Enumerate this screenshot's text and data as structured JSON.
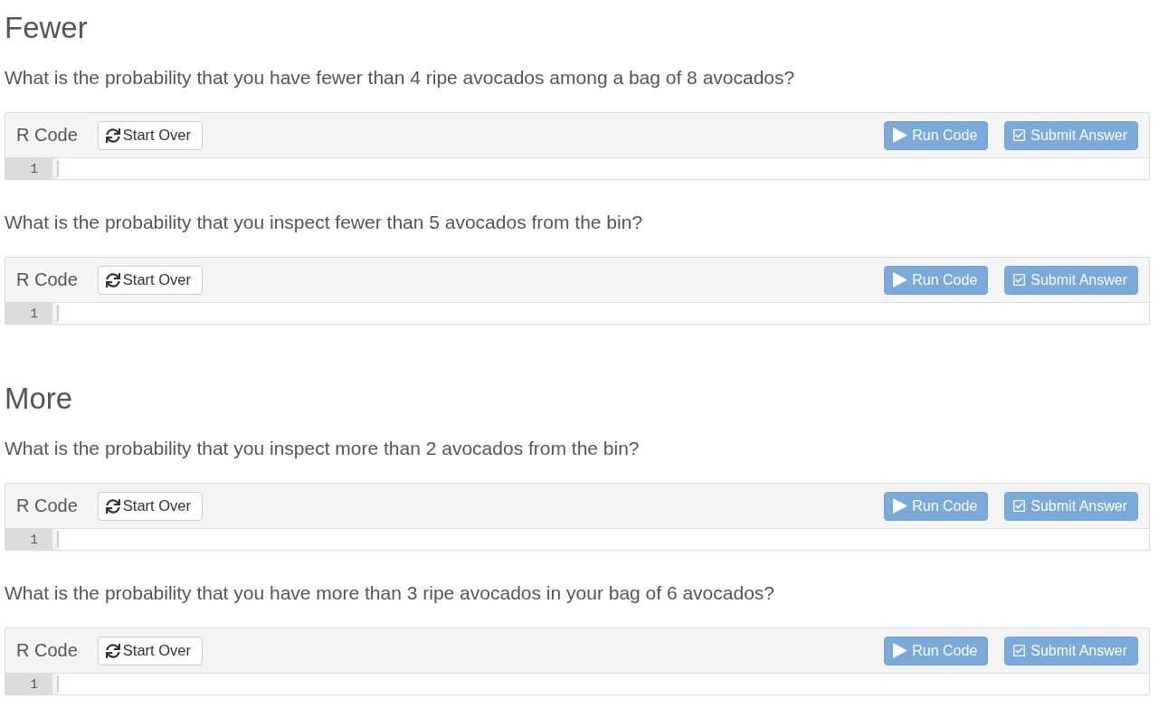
{
  "sections": [
    {
      "heading": "Fewer",
      "exercises": [
        {
          "question": "What is the probability that you have fewer than 4 ripe avocados among a bag of 8 avocados?",
          "label": "R Code",
          "start_over": "Start Over",
          "run": "Run Code",
          "submit": "Submit Answer",
          "line_number": "1"
        },
        {
          "question": "What is the probability that you inspect fewer than 5 avocados from the bin?",
          "label": "R Code",
          "start_over": "Start Over",
          "run": "Run Code",
          "submit": "Submit Answer",
          "line_number": "1"
        }
      ]
    },
    {
      "heading": "More",
      "exercises": [
        {
          "question": "What is the probability that you inspect more than 2 avocados from the bin?",
          "label": "R Code",
          "start_over": "Start Over",
          "run": "Run Code",
          "submit": "Submit Answer",
          "line_number": "1"
        },
        {
          "question": "What is the probability that you have more than 3 ripe avocados in your bag of 6 avocados?",
          "label": "R Code",
          "start_over": "Start Over",
          "run": "Run Code",
          "submit": "Submit Answer",
          "line_number": "1"
        }
      ]
    }
  ]
}
